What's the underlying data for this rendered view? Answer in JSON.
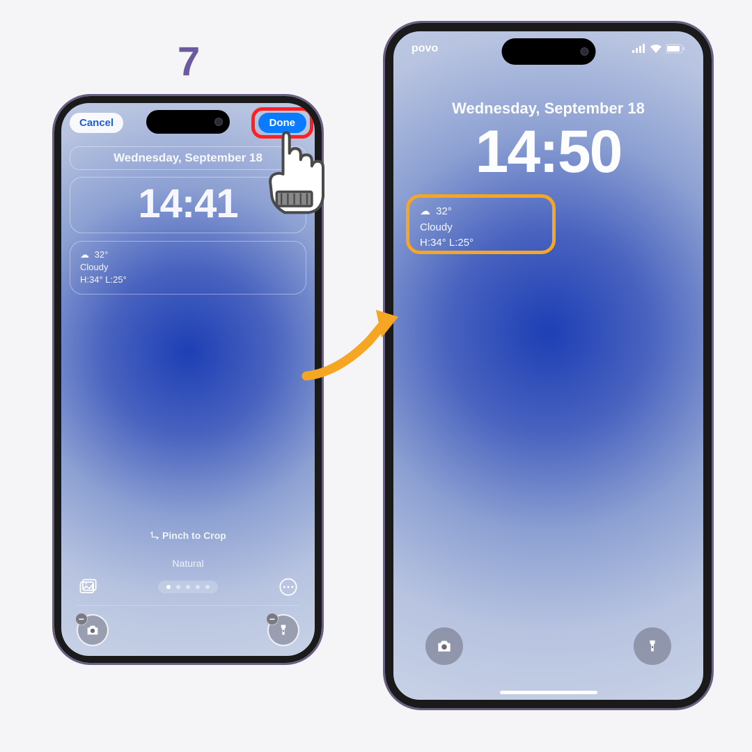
{
  "step_number": "7",
  "colors": {
    "highlight_red": "#ff2020",
    "highlight_orange": "#f5a623",
    "accent_blue": "#0a7aff",
    "step_purple": "#6b5b9e"
  },
  "phone_left": {
    "mode": "edit",
    "cancel_label": "Cancel",
    "done_label": "Done",
    "date": "Wednesday, September 18",
    "time": "14:41",
    "widget": {
      "temp": "32°",
      "condition": "Cloudy",
      "hi_lo": "H:34° L:25°"
    },
    "pinch_label": "Pinch to Crop",
    "effect_label": "Natural",
    "page_dots": {
      "count": 5,
      "active": 0
    }
  },
  "phone_right": {
    "carrier": "povo",
    "date": "Wednesday, September 18",
    "time": "14:50",
    "widget": {
      "temp": "32°",
      "condition": "Cloudy",
      "hi_lo": "H:34° L:25°"
    }
  }
}
